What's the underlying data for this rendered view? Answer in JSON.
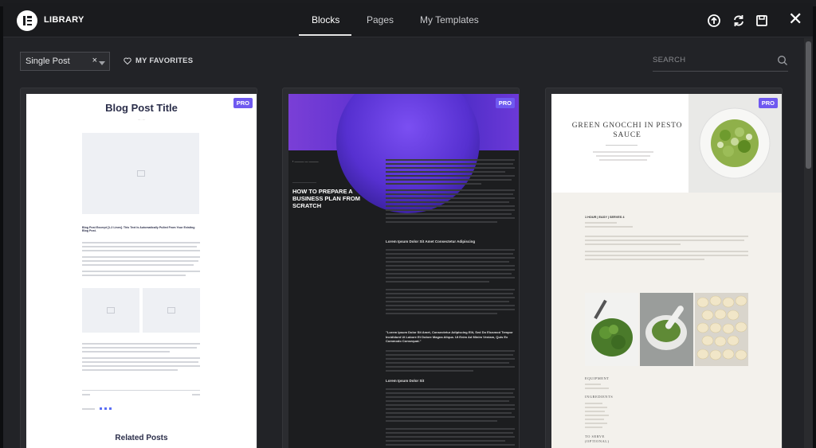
{
  "header": {
    "title": "LIBRARY",
    "tabs": [
      {
        "label": "Blocks",
        "active": true
      },
      {
        "label": "Pages",
        "active": false
      },
      {
        "label": "My Templates",
        "active": false
      }
    ],
    "icons": [
      "upload-icon",
      "sync-icon",
      "save-icon",
      "close-icon"
    ]
  },
  "toolbar": {
    "filter_value": "Single Post",
    "favorites_label": "MY FAVORITES",
    "search_placeholder": "SEARCH"
  },
  "templates": [
    {
      "badge": "PRO",
      "title": "Blog Post Title",
      "excerpt": "Blog Post Excerpt [1-2 Lines]. This Text Is Automatically Pulled From Your Existing Blog Post.",
      "related": "Related Posts"
    },
    {
      "badge": "PRO",
      "heading": "HOW TO PREPARE A BUSINESS PLAN FROM SCRATCH",
      "subheading_1": "Lorem Ipsum Dolor Sit Amet Consectetur Adipiscing",
      "quote": "\"Lorem Ipsum Dolor Sit Amet, Consectetur Adipiscing Elit, Sed Do Eiusmod Tempor Incididunt Ut Labore Et Dolore Magna Aliqua. Ut Enim Ad Minim Veniam, Quis Ex Commodo Consequat.\"",
      "subheading_2": "Lorem Ipsum Dolor Sit"
    },
    {
      "badge": "PRO",
      "title": "GREEN GNOCCHI IN PESTO SAUCE",
      "meta": "1 HOUR | EASY | SERVES 4",
      "section_1": "EQUIPMENT",
      "section_2": "INGREDIENTS",
      "section_3": "TO SERVE (OPTIONAL)"
    }
  ],
  "colors": {
    "accent_pro": "#6f59f0",
    "modal_bg": "#222327",
    "header_bg": "#1a1b1e"
  }
}
